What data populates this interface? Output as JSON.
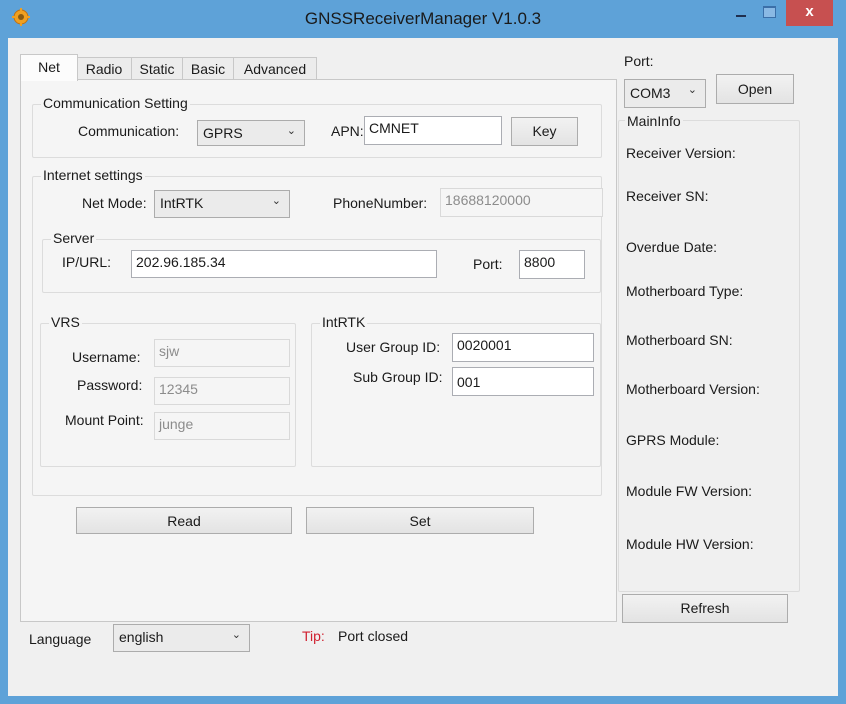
{
  "window": {
    "title": "GNSSReceiverManager V1.0.3",
    "close_glyph": "x",
    "icons": {
      "app": "gear-icon",
      "minimize": "minimize-icon",
      "maximize": "maximize-icon",
      "close": "close-icon"
    }
  },
  "tabs": [
    {
      "label": "Net",
      "active": true
    },
    {
      "label": "Radio",
      "active": false
    },
    {
      "label": "Static",
      "active": false
    },
    {
      "label": "Basic",
      "active": false
    },
    {
      "label": "Advanced",
      "active": false
    }
  ],
  "net": {
    "communication_setting": {
      "title": "Communication Setting",
      "communication_label": "Communication:",
      "communication_value": "GPRS",
      "apn_label": "APN:",
      "apn_value": "CMNET",
      "key_button": "Key"
    },
    "internet_settings": {
      "title": "Internet settings",
      "net_mode_label": "Net Mode:",
      "net_mode_value": "IntRTK",
      "phone_label": "PhoneNumber:",
      "phone_value": "18688120000"
    },
    "server": {
      "title": "Server",
      "ip_label": "IP/URL:",
      "ip_value": "202.96.185.34",
      "port_label": "Port:",
      "port_value": "8800"
    },
    "vrs": {
      "title": "VRS",
      "username_label": "Username:",
      "username_value": "sjw",
      "password_label": "Password:",
      "password_value": "12345",
      "mount_label": "Mount Point:",
      "mount_value": "junge"
    },
    "intrtk": {
      "title": "IntRTK",
      "user_group_label": "User Group ID:",
      "user_group_value": "0020001",
      "sub_group_label": "Sub Group ID:",
      "sub_group_value": "001"
    },
    "read_button": "Read",
    "set_button": "Set"
  },
  "port_panel": {
    "label": "Port:",
    "value": "COM3",
    "open_button": "Open"
  },
  "main_info": {
    "title": "MainInfo",
    "fields": [
      "Receiver Version:",
      "Receiver SN:",
      "Overdue Date:",
      "Motherboard Type:",
      "Motherboard SN:",
      "Motherboard Version:",
      "GPRS Module:",
      "Module FW Version:",
      "Module HW Version:"
    ],
    "refresh_button": "Refresh"
  },
  "footer": {
    "language_label": "Language",
    "language_value": "english",
    "tip_label": "Tip:",
    "tip_value": "Port closed"
  },
  "colors": {
    "titlebar": "#5ea2d8",
    "close": "#c75050",
    "tip": "#d02030"
  }
}
